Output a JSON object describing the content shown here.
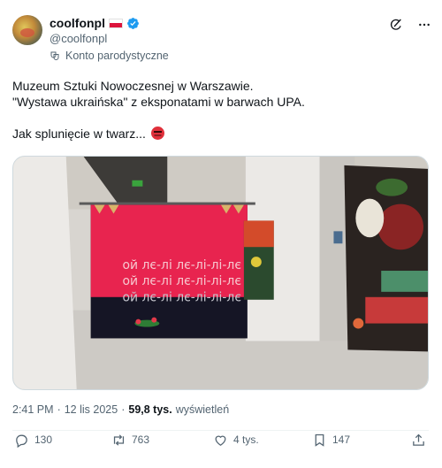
{
  "author": {
    "name": "coolfonpl",
    "handle": "@coolfonpl",
    "label": "Konto parodystyczne",
    "flag": "poland-flag",
    "verified_color": "#1d9bf0"
  },
  "post": {
    "line1": "Muzeum Sztuki Nowoczesnej w Warszawie.",
    "line2": "\"Wystawa ukraińska\" z eksponatami w barwach UPA.",
    "line3": "Jak splunięcie w twarz...",
    "emoji": "angry-face-emoji",
    "banner_text": "ой лє-лі лє-лі-лі-лє"
  },
  "meta": {
    "time": "2:41 PM",
    "sep1": "·",
    "date": "12 lis 2025",
    "sep2": "·",
    "views_count": "59,8 tys.",
    "views_label": "wyświetleń"
  },
  "actions": {
    "replies": "130",
    "reposts": "763",
    "likes": "4 tys.",
    "bookmarks": "147"
  }
}
